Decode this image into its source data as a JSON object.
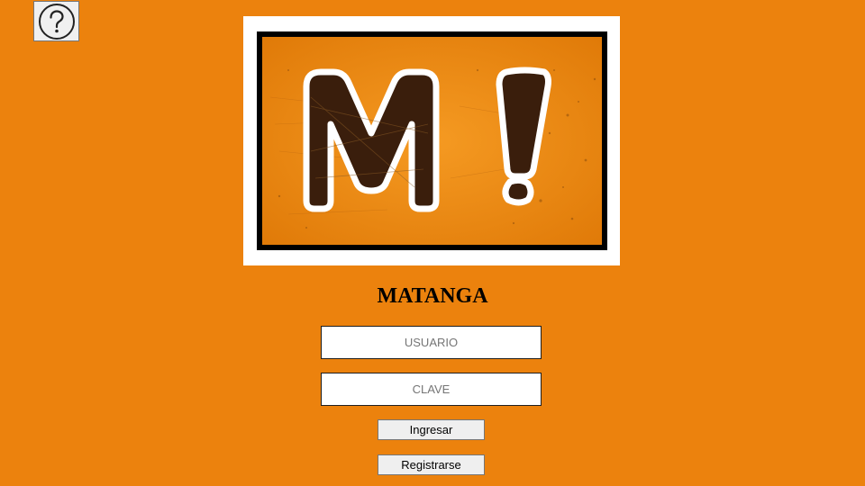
{
  "header": {
    "help_icon": "question-circle-icon"
  },
  "logo": {
    "glyph_letter": "M",
    "glyph_mark": "!",
    "colors": {
      "background": "#EC820D",
      "panel": "#F28A16",
      "border": "#000000",
      "letter_fill": "#3A1E0C",
      "letter_outline": "#FFFFFF"
    }
  },
  "title": "MATANGA",
  "login_form": {
    "username_placeholder": "USUARIO",
    "password_placeholder": "CLAVE",
    "login_label": "Ingresar",
    "register_label": "Registrarse"
  },
  "theme": {
    "page_background": "#EC820D"
  }
}
